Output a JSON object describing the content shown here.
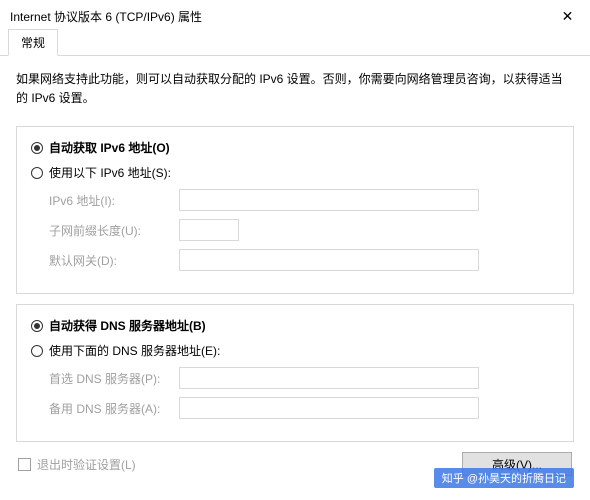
{
  "titlebar": {
    "title": "Internet 协议版本 6 (TCP/IPv6) 属性"
  },
  "tabs": {
    "general": "常规"
  },
  "description": "如果网络支持此功能，则可以自动获取分配的 IPv6 设置。否则，你需要向网络管理员咨询，以获得适当的 IPv6 设置。",
  "ip": {
    "auto_label": "自动获取 IPv6 地址(O)",
    "manual_label": "使用以下 IPv6 地址(S):",
    "auto_selected": true,
    "fields": {
      "address_label": "IPv6 地址(I):",
      "address_value": "",
      "prefix_label": "子网前缀长度(U):",
      "prefix_value": "",
      "gateway_label": "默认网关(D):",
      "gateway_value": ""
    }
  },
  "dns": {
    "auto_label": "自动获得 DNS 服务器地址(B)",
    "manual_label": "使用下面的 DNS 服务器地址(E):",
    "auto_selected": true,
    "fields": {
      "preferred_label": "首选 DNS 服务器(P):",
      "preferred_value": "",
      "alternate_label": "备用 DNS 服务器(A):",
      "alternate_value": ""
    }
  },
  "validate_on_exit_label": "退出时验证设置(L)",
  "validate_on_exit_checked": false,
  "advanced_button": "高级(V)...",
  "watermark": "知乎 @孙昊天的折腾日记"
}
